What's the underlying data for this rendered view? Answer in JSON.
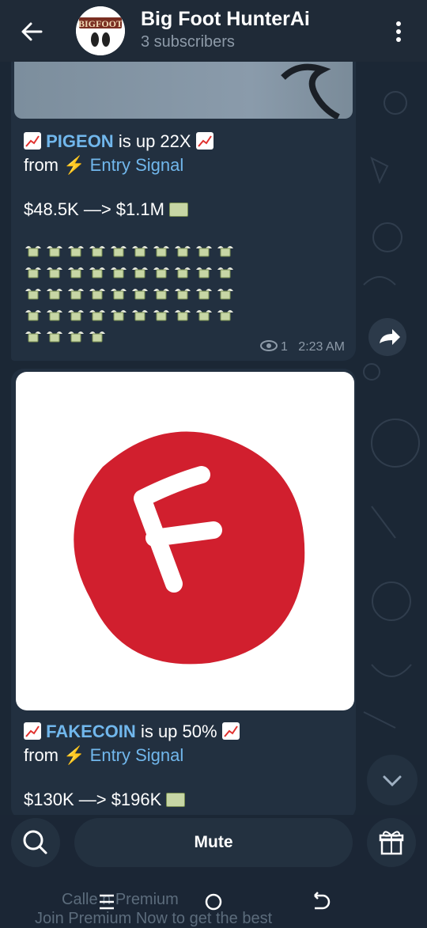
{
  "header": {
    "title": "Big Foot HunterAi",
    "subtitle": "3 subscribers",
    "avatar_text": "BIGFOOT"
  },
  "message1": {
    "coin": "PIGEON",
    "gain_text": "is up 22X",
    "from_label": "from",
    "source_link": "Entry Signal",
    "price_change": "$48.5K —> $1.1M",
    "views": "1",
    "time": "2:23 AM",
    "money_emoji_rows": [
      10,
      10,
      10,
      10,
      4
    ]
  },
  "message2": {
    "logo_letter": "F",
    "coin": "FAKECOIN",
    "gain_text": "is up 50%",
    "from_label": "from",
    "source_link": "Entry Signal",
    "price_change": "$130K —> $196K"
  },
  "bottom": {
    "mute_label": "Mute",
    "preview_title": "Calle  n Premium",
    "preview_text": "Join Premium Now to get the best"
  },
  "colors": {
    "background": "#1b2735",
    "bubble": "#223040",
    "link": "#71b7ec",
    "logo_red": "#d11f2e"
  },
  "icons": [
    "back-arrow-icon",
    "more-vert-icon",
    "chart-up-emoji",
    "lightning-emoji",
    "cash-emoji",
    "money-wings-emoji",
    "eye-icon",
    "share-icon",
    "chevron-down-icon",
    "search-icon",
    "gift-icon",
    "menu-icon",
    "home-circle-icon",
    "back-nav-icon"
  ]
}
